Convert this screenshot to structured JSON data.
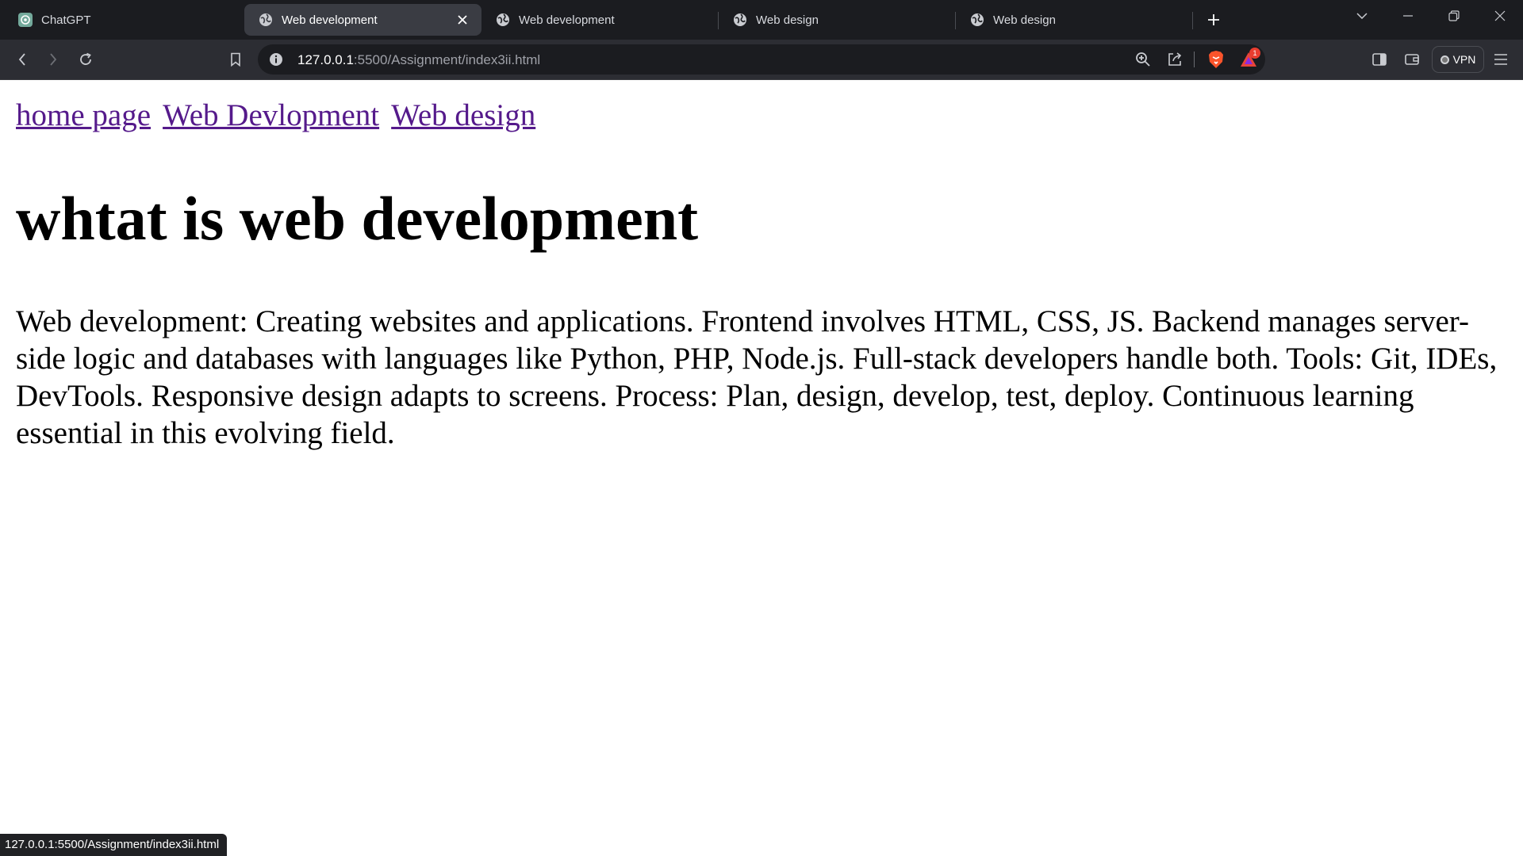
{
  "browser": {
    "tabs": [
      {
        "title": "ChatGPT",
        "icon": "chatgpt-icon",
        "active": false
      },
      {
        "title": "Web development",
        "icon": "globe-icon",
        "active": true
      },
      {
        "title": "Web development",
        "icon": "globe-icon",
        "active": false
      },
      {
        "title": "Web design",
        "icon": "globe-icon",
        "active": false
      },
      {
        "title": "Web design",
        "icon": "globe-icon",
        "active": false
      }
    ],
    "url_host": "127.0.0.1",
    "url_path": ":5500/Assignment/index3ii.html",
    "vpn_label": "VPN",
    "notification_count": "1",
    "status_url": "127.0.0.1:5500/Assignment/index3ii.html"
  },
  "page": {
    "nav_links": [
      "home page",
      "Web Devlopment",
      "Web design"
    ],
    "heading": "whtat is web development",
    "paragraph": "Web development: Creating websites and applications. Frontend involves HTML, CSS, JS. Backend manages server-side logic and databases with languages like Python, PHP, Node.js. Full-stack developers handle both. Tools: Git, IDEs, DevTools. Responsive design adapts to screens. Process: Plan, design, develop, test, deploy. Continuous learning essential in this evolving field."
  },
  "colors": {
    "link_visited": "#551a8b",
    "tabstrip_bg": "#1b1c20",
    "toolbar_bg": "#2c2d33",
    "brave_orange": "#fb542b"
  }
}
